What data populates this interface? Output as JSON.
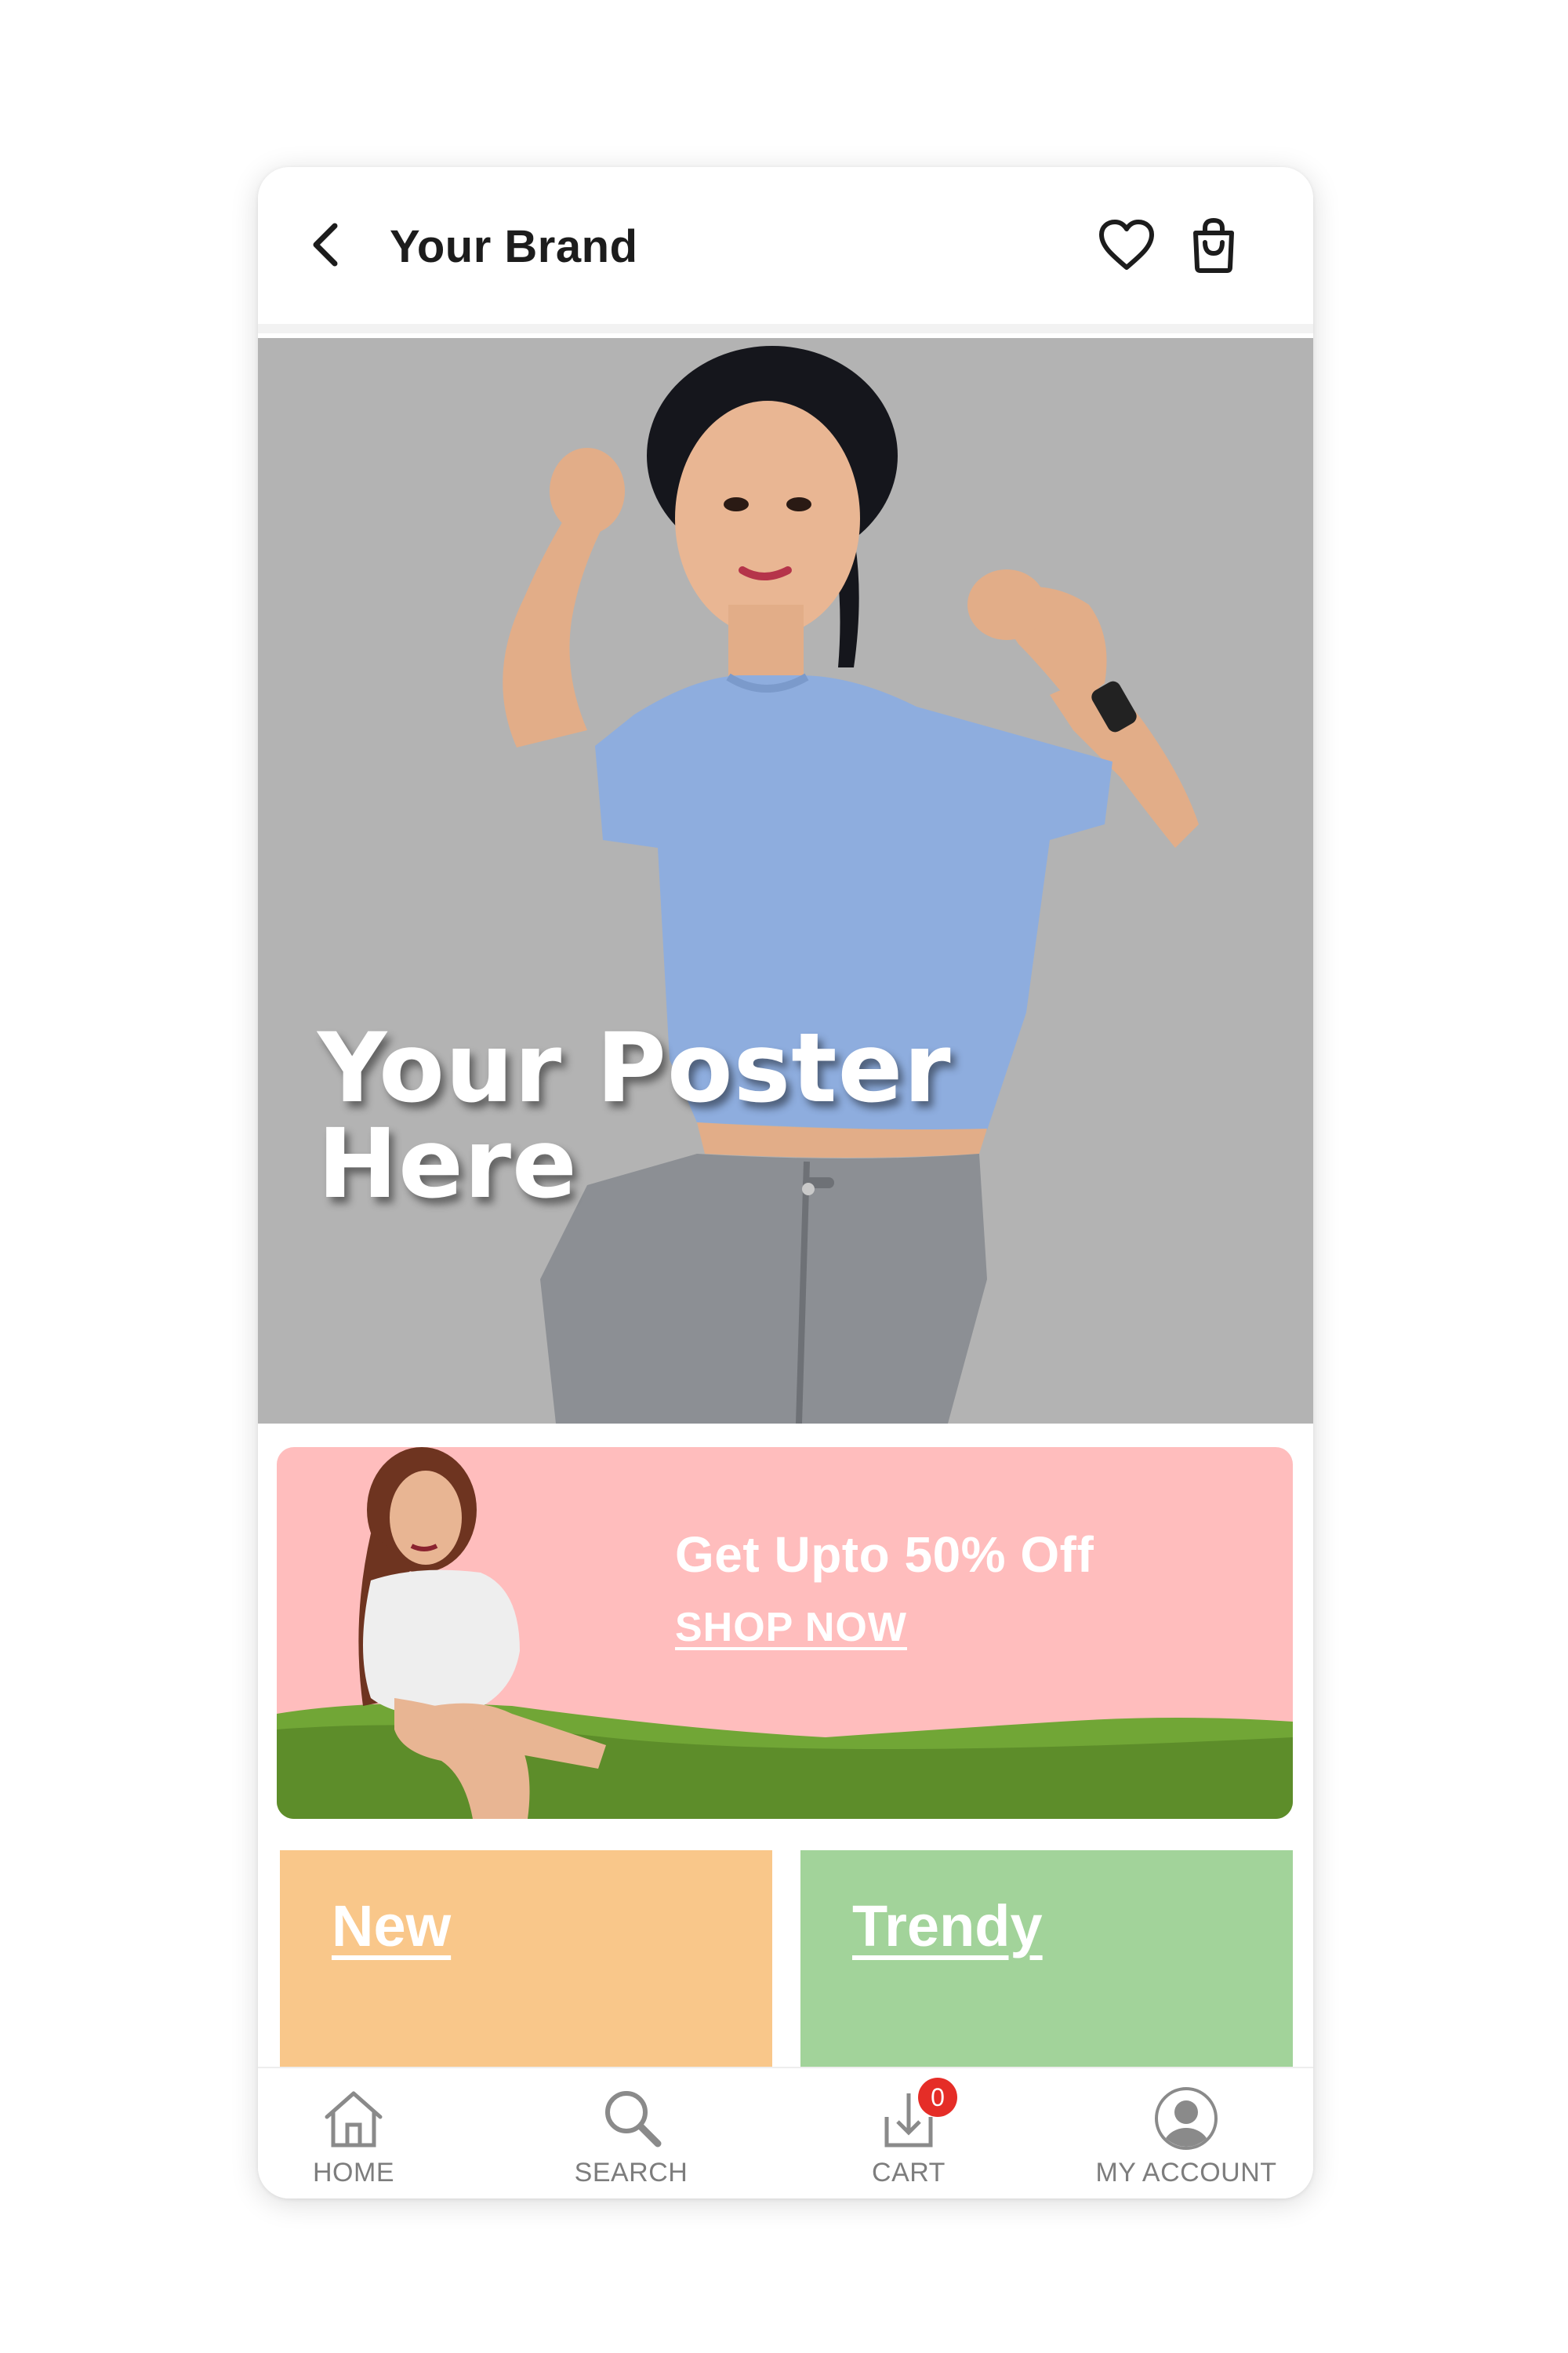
{
  "header": {
    "brand": "Your Brand",
    "icons": {
      "back": "chevron-left-icon",
      "wishlist": "heart-icon",
      "cart": "shopping-bag-icon"
    }
  },
  "hero": {
    "line1": "Your Poster",
    "line2": "Here",
    "background": "#b3b3b3"
  },
  "promo": {
    "title": "Get Upto 50% Off",
    "link": "SHOP NOW",
    "background": "#ffbdbd"
  },
  "categories": [
    {
      "label": "New",
      "color": "#f9c78a"
    },
    {
      "label": "Trendy",
      "color": "#a2d39a"
    }
  ],
  "bottom_nav": {
    "items": [
      {
        "label": "HOME",
        "icon": "home-icon"
      },
      {
        "label": "SEARCH",
        "icon": "search-icon"
      },
      {
        "label": "CART",
        "icon": "cart-download-icon",
        "badge": "0"
      },
      {
        "label": "MY ACCOUNT",
        "icon": "account-icon"
      }
    ],
    "badge_color": "#e52d27"
  }
}
